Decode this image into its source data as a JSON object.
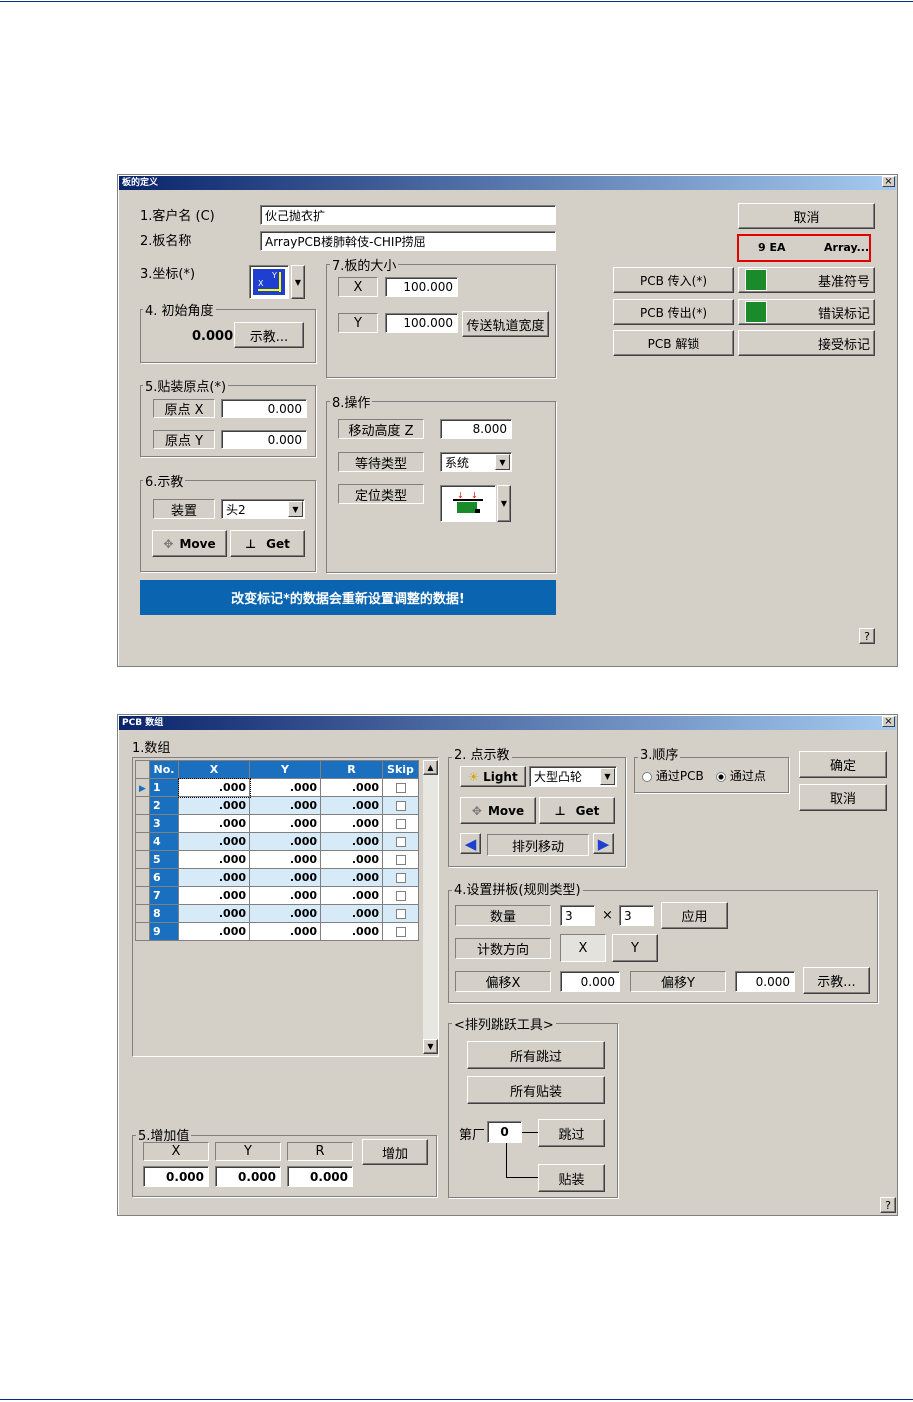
{
  "dlg1": {
    "title": "板的定义",
    "customer_label": "1.客户名 (C)",
    "customer_value": "伙己抛衣扩",
    "board_label": "2.板名称",
    "board_value": "ArrayPCB楼肺斡伎-CHIP捞屈",
    "coord_label": "3.坐标(*)",
    "angle_group": "4. 初始角度",
    "angle_value": "0.000",
    "teach_btn": "示教...",
    "origin_group": "5.贴装原点(*)",
    "origin_x_label": "原点 X",
    "origin_x": "0.000",
    "origin_y_label": "原点 Y",
    "origin_y": "0.000",
    "teach_group": "6.示教",
    "device_label": "装置",
    "device_value": "头2",
    "move_btn": "Move",
    "get_btn": "Get",
    "size_group": "7.板的大小",
    "size_x_label": "X",
    "size_x": "100.000",
    "size_y_label": "Y",
    "size_y": "100.000",
    "conveyor_btn": "传送轨道宽度",
    "op_group": "8.操作",
    "move_height_label": "移动高度 Z",
    "move_height": "8.000",
    "wait_type_label": "等待类型",
    "wait_type": "系统",
    "locate_type_label": "定位类型",
    "cancel_btn": "取消",
    "array_count": "9 EA",
    "array_btn": "Array...",
    "pcb_in_btn": "PCB 传入(*)",
    "pcb_out_btn": "PCB 传出(*)",
    "pcb_unlock_btn": "PCB 解锁",
    "fiducial_btn": "基准符号",
    "bad_mark_btn": "错误标记",
    "accept_mark_btn": "接受标记",
    "status_msg": "改变标记*的数据会重新设置调整的数据!",
    "help": "?"
  },
  "dlg2": {
    "title": "PCB 数组",
    "array_group": "1.数组",
    "columns": [
      "No.",
      "X",
      "Y",
      "R",
      "Skip"
    ],
    "rows": [
      {
        "no": "1",
        "x": ".000",
        "y": ".000",
        "r": ".000"
      },
      {
        "no": "2",
        "x": ".000",
        "y": ".000",
        "r": ".000"
      },
      {
        "no": "3",
        "x": ".000",
        "y": ".000",
        "r": ".000"
      },
      {
        "no": "4",
        "x": ".000",
        "y": ".000",
        "r": ".000"
      },
      {
        "no": "5",
        "x": ".000",
        "y": ".000",
        "r": ".000"
      },
      {
        "no": "6",
        "x": ".000",
        "y": ".000",
        "r": ".000"
      },
      {
        "no": "7",
        "x": ".000",
        "y": ".000",
        "r": ".000"
      },
      {
        "no": "8",
        "x": ".000",
        "y": ".000",
        "r": ".000"
      },
      {
        "no": "9",
        "x": ".000",
        "y": ".000",
        "r": ".000"
      }
    ],
    "teach_group": "2. 点示教",
    "light_btn": "Light",
    "light_select": "大型凸轮",
    "move_btn": "Move",
    "get_btn": "Get",
    "array_move": "排列移动",
    "order_group": "3.顺序",
    "order_pcb": "通过PCB",
    "order_point": "通过点",
    "ok_btn": "确定",
    "cancel_btn": "取消",
    "panel_group": "4.设置拼板(规则类型)",
    "qty_label": "数量",
    "qty_x": "3",
    "times": "×",
    "qty_y": "3",
    "apply_btn": "应用",
    "count_dir_label": "计数方向",
    "dir_x": "X",
    "dir_y": "Y",
    "offset_x_label": "偏移X",
    "offset_x": "0.000",
    "offset_y_label": "偏移Y",
    "offset_y": "0.000",
    "teach_btn": "示教...",
    "skip_tools_group": "<排列跳跃工具>",
    "skip_all_btn": "所有跳过",
    "mount_all_btn": "所有贴装",
    "nth_label": "第厂",
    "nth_value": "0",
    "skip_btn": "跳过",
    "mount_btn": "贴装",
    "inc_group": "5.增加值",
    "inc_x_label": "X",
    "inc_y_label": "Y",
    "inc_r_label": "R",
    "inc_x": "0.000",
    "inc_y": "0.000",
    "inc_r": "0.000",
    "add_btn": "增加",
    "help": "?"
  }
}
